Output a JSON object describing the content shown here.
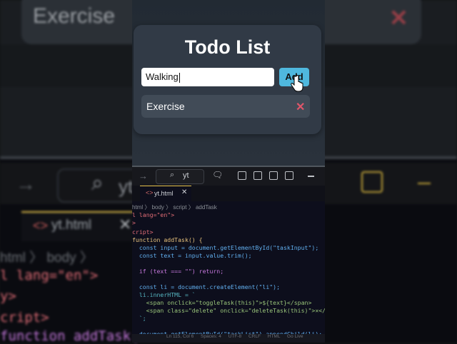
{
  "background": {
    "task_text": "Exercise",
    "delete_glyph": "✕",
    "search_text": "yt",
    "tab_label": "yt.html",
    "breadcrumb": "html  〉 body 〉",
    "code": [
      "l lang=\"en\">",
      "y>",
      "cript>",
      "function addTask("
    ]
  },
  "app": {
    "title": "Todo List",
    "input": {
      "value": "Walking",
      "placeholder": ""
    },
    "add_label": "Add",
    "tasks": [
      {
        "text": "Exercise",
        "delete_glyph": "✕"
      }
    ]
  },
  "editor": {
    "search_text": "yt",
    "tab": {
      "label": "yt.html",
      "close": "✕"
    },
    "breadcrumb": [
      "html",
      "body",
      "script",
      "addTask"
    ],
    "code_lines": [
      "l lang=\"en\">",
      ">",
      "",
      "cript>",
      "function addTask() {",
      "  const input = document.getElementById(\"taskInput\");",
      "  const text = input.value.trim();",
      "",
      "  if (text === \"\") return;",
      "",
      "  const li = document.createElement(\"li\");",
      "  li.innerHTML = `",
      "    <span onclick=\"toggleTask(this)\">${text}</span>",
      "    <span class=\"delete\" onclick=\"deleteTask(this)\">✕</span>",
      "  `;",
      "",
      "  document.getElementById(\"taskList\").appendChild(li);"
    ],
    "status": {
      "position": "Ln 115, Col 6",
      "spaces": "Spaces: 4",
      "encoding": "UTF-8",
      "eol": "CRLF",
      "language": "HTML",
      "golive": "Go Live"
    }
  },
  "colors": {
    "accent": "#4fb8de",
    "delete": "#e0566a",
    "tab_border": "#e6c24a"
  },
  "icons": [
    "back-arrow-icon",
    "search-icon",
    "chat-icon",
    "layout-icon",
    "minimize-icon",
    "html-file-icon",
    "close-icon",
    "hand-cursor-icon"
  ]
}
